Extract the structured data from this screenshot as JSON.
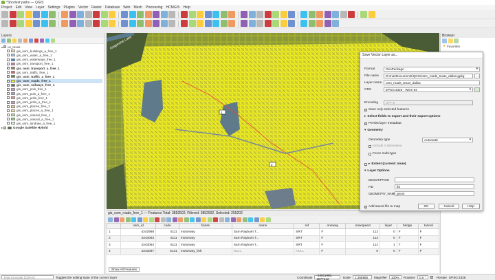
{
  "window": {
    "title": "*Shortest paths — QGIS"
  },
  "menu": [
    "Project",
    "Edit",
    "View",
    "Layer",
    "Settings",
    "Plugins",
    "Vector",
    "Raster",
    "Database",
    "Web",
    "Mesh",
    "Processing",
    "HCMGIS",
    "Help"
  ],
  "layers_panel": {
    "title": "Layers",
    "group": "us_texas",
    "items": [
      {
        "name": "gis_osm_buildings_a_free_1",
        "checked": false,
        "color": "#e8d6b3",
        "bold": false
      },
      {
        "name": "gis_osm_water_a_free_1",
        "checked": false,
        "color": "#9fc5e8",
        "bold": false
      },
      {
        "name": "gis_osm_waterways_free_1",
        "checked": false,
        "color": "#3d85c6",
        "bold": false
      },
      {
        "name": "gis_osm_transport_free_1",
        "checked": false,
        "color": "#c27ba0",
        "bold": false
      },
      {
        "name": "gis_osm_transport_a_free_1",
        "checked": true,
        "color": "#9e7b5b",
        "bold": true
      },
      {
        "name": "gis_osm_traffic_free_1",
        "checked": false,
        "color": "#e06666",
        "bold": false
      },
      {
        "name": "gis_osm_traffic_a_free_1",
        "checked": true,
        "color": "#6a8a3a",
        "bold": true
      },
      {
        "name": "gis_osm_roads_free_1",
        "checked": true,
        "color": "#f6ef1b",
        "bold": true
      },
      {
        "name": "gis_osm_railways_free_1",
        "checked": true,
        "color": "#666666",
        "bold": true
      },
      {
        "name": "gis_osm_pois_free_1",
        "checked": false,
        "color": "#c9a0dc",
        "bold": false
      },
      {
        "name": "gis_osm_pois_a_free_1",
        "checked": false,
        "color": "#b4a7d6",
        "bold": false
      },
      {
        "name": "gis_osm_pofw_free_1",
        "checked": false,
        "color": "#ea9999",
        "bold": false
      },
      {
        "name": "gis_osm_pofw_a_free_1",
        "checked": false,
        "color": "#d5a6bd",
        "bold": false
      },
      {
        "name": "gis_osm_places_free_1",
        "checked": false,
        "color": "#f9cb9c",
        "bold": false
      },
      {
        "name": "gis_osm_places_a_free_1",
        "checked": false,
        "color": "#ffe599",
        "bold": false
      },
      {
        "name": "gis_osm_natural_free_1",
        "checked": false,
        "color": "#b6d7a8",
        "bold": false
      },
      {
        "name": "gis_osm_natural_a_free_1",
        "checked": false,
        "color": "#93c47d",
        "bold": false
      },
      {
        "name": "gis_osm_landuse_a_free_1",
        "checked": false,
        "color": "#d9ead3",
        "bold": false
      }
    ],
    "basemap": "Google Satellite Hybrid"
  },
  "browser_panel": {
    "title": "Browser",
    "favorites": "Favorites"
  },
  "map": {
    "labels": [
      "Grapevine Lake",
      "3"
    ],
    "route_nodes": [
      "1",
      "2"
    ]
  },
  "attribute_table": {
    "title": "gis_osm_roads_free_1 — Features Total: 3852502, Filtered: 3852502, Selected: 255202",
    "columns": [
      "osm_id",
      "code",
      "fclass",
      "name",
      "ref",
      "oneway",
      "maxspeed",
      "layer",
      "bridge",
      "tunnel"
    ],
    "rows": [
      [
        "1",
        "4342988",
        "5111",
        "motorway",
        "Sam Rayburn T...",
        "SRT",
        "F",
        "112",
        "0",
        "F",
        "F"
      ],
      [
        "2",
        "4343083",
        "5111",
        "motorway",
        "Sam Rayburn T...",
        "SRT",
        "F",
        "112",
        "0",
        "F",
        "F"
      ],
      [
        "3",
        "4343084",
        "5111",
        "motorway",
        "Sam Rayburn T...",
        "SRT",
        "F",
        "112",
        "1",
        "T",
        "F"
      ],
      [
        "4",
        "4343087",
        "5131",
        "motorway_link",
        "NULL",
        "NULL",
        "F",
        "0",
        "0",
        "F",
        "F"
      ]
    ],
    "show_all": "Show All Features"
  },
  "dialog": {
    "title": "Save Vector Layer as...",
    "format_label": "Format",
    "format_value": "GeoPackage",
    "filename_label": "File name",
    "filename_value": "D:\\mar\\Documents\\QGIS\\osm_roads_texas_dallas.gpkg",
    "layername_label": "Layer name",
    "layername_value": "osm_roads_texas_dallas",
    "crs_label": "CRS",
    "crs_value": "EPSG:4326 - WGS 84",
    "encoding_label": "Encoding",
    "encoding_value": "UTF-8",
    "save_selected": "Save only selected features",
    "select_fields": "Select fields to export and their export options",
    "persist_metadata": "Persist layer metadata",
    "geometry_section": "Geometry",
    "geom_type_label": "Geometry type",
    "geom_type_value": "Automatic",
    "include_z": "Include z-dimension",
    "force_multi": "Force multi-type",
    "extent": "Extent (current: none)",
    "layer_options": "Layer Options",
    "description_label": "DESCRIPTION",
    "description_value": "",
    "fid_label": "FID",
    "fid_value": "fid",
    "geometry_name_label": "GEOMETRY_NAME",
    "geometry_name_value": "geom",
    "add_to_map": "Add saved file to map",
    "ok": "OK",
    "cancel": "Cancel",
    "help": "Help"
  },
  "statusbar": {
    "search_placeholder": "Type to locate (Ctrl+K)",
    "message": "Toggles the editing state of the current layer",
    "coordinate_label": "Coordinate",
    "coordinate_value": "-10811980, 3877212",
    "scale_label": "Scale",
    "scale_value": "1:266965",
    "magnifier_label": "Magnifier",
    "magnifier_value": "100%",
    "rotation_label": "Rotation",
    "rotation_value": "0.0 °",
    "render_label": "Render",
    "crs": "EPSG:4326"
  }
}
